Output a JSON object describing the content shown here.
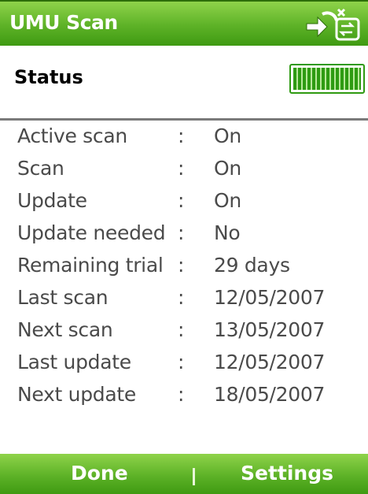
{
  "app": {
    "title": "UMU Scan",
    "connectivity_icon": "connectivity-icon",
    "accent_color": "#5db227"
  },
  "status": {
    "heading": "Status",
    "battery_icon": "battery-icon",
    "battery_level": 1.0
  },
  "details": [
    {
      "label": "Active scan",
      "separator": ":",
      "value": "On"
    },
    {
      "label": "Scan",
      "separator": ":",
      "value": "On"
    },
    {
      "label": "Update",
      "separator": ":",
      "value": "On"
    },
    {
      "label": "Update needed",
      "separator": ":",
      "value": "No"
    },
    {
      "label": "Remaining trial",
      "separator": ":",
      "value": "29 days"
    },
    {
      "label": "Last scan",
      "separator": ":",
      "value": "12/05/2007"
    },
    {
      "label": "Next scan",
      "separator": ":",
      "value": "13/05/2007"
    },
    {
      "label": "Last update",
      "separator": ":",
      "value": "12/05/2007"
    },
    {
      "label": "Next update",
      "separator": ":",
      "value": "18/05/2007"
    }
  ],
  "softkeys": {
    "left_label": "Done",
    "right_label": "Settings"
  }
}
